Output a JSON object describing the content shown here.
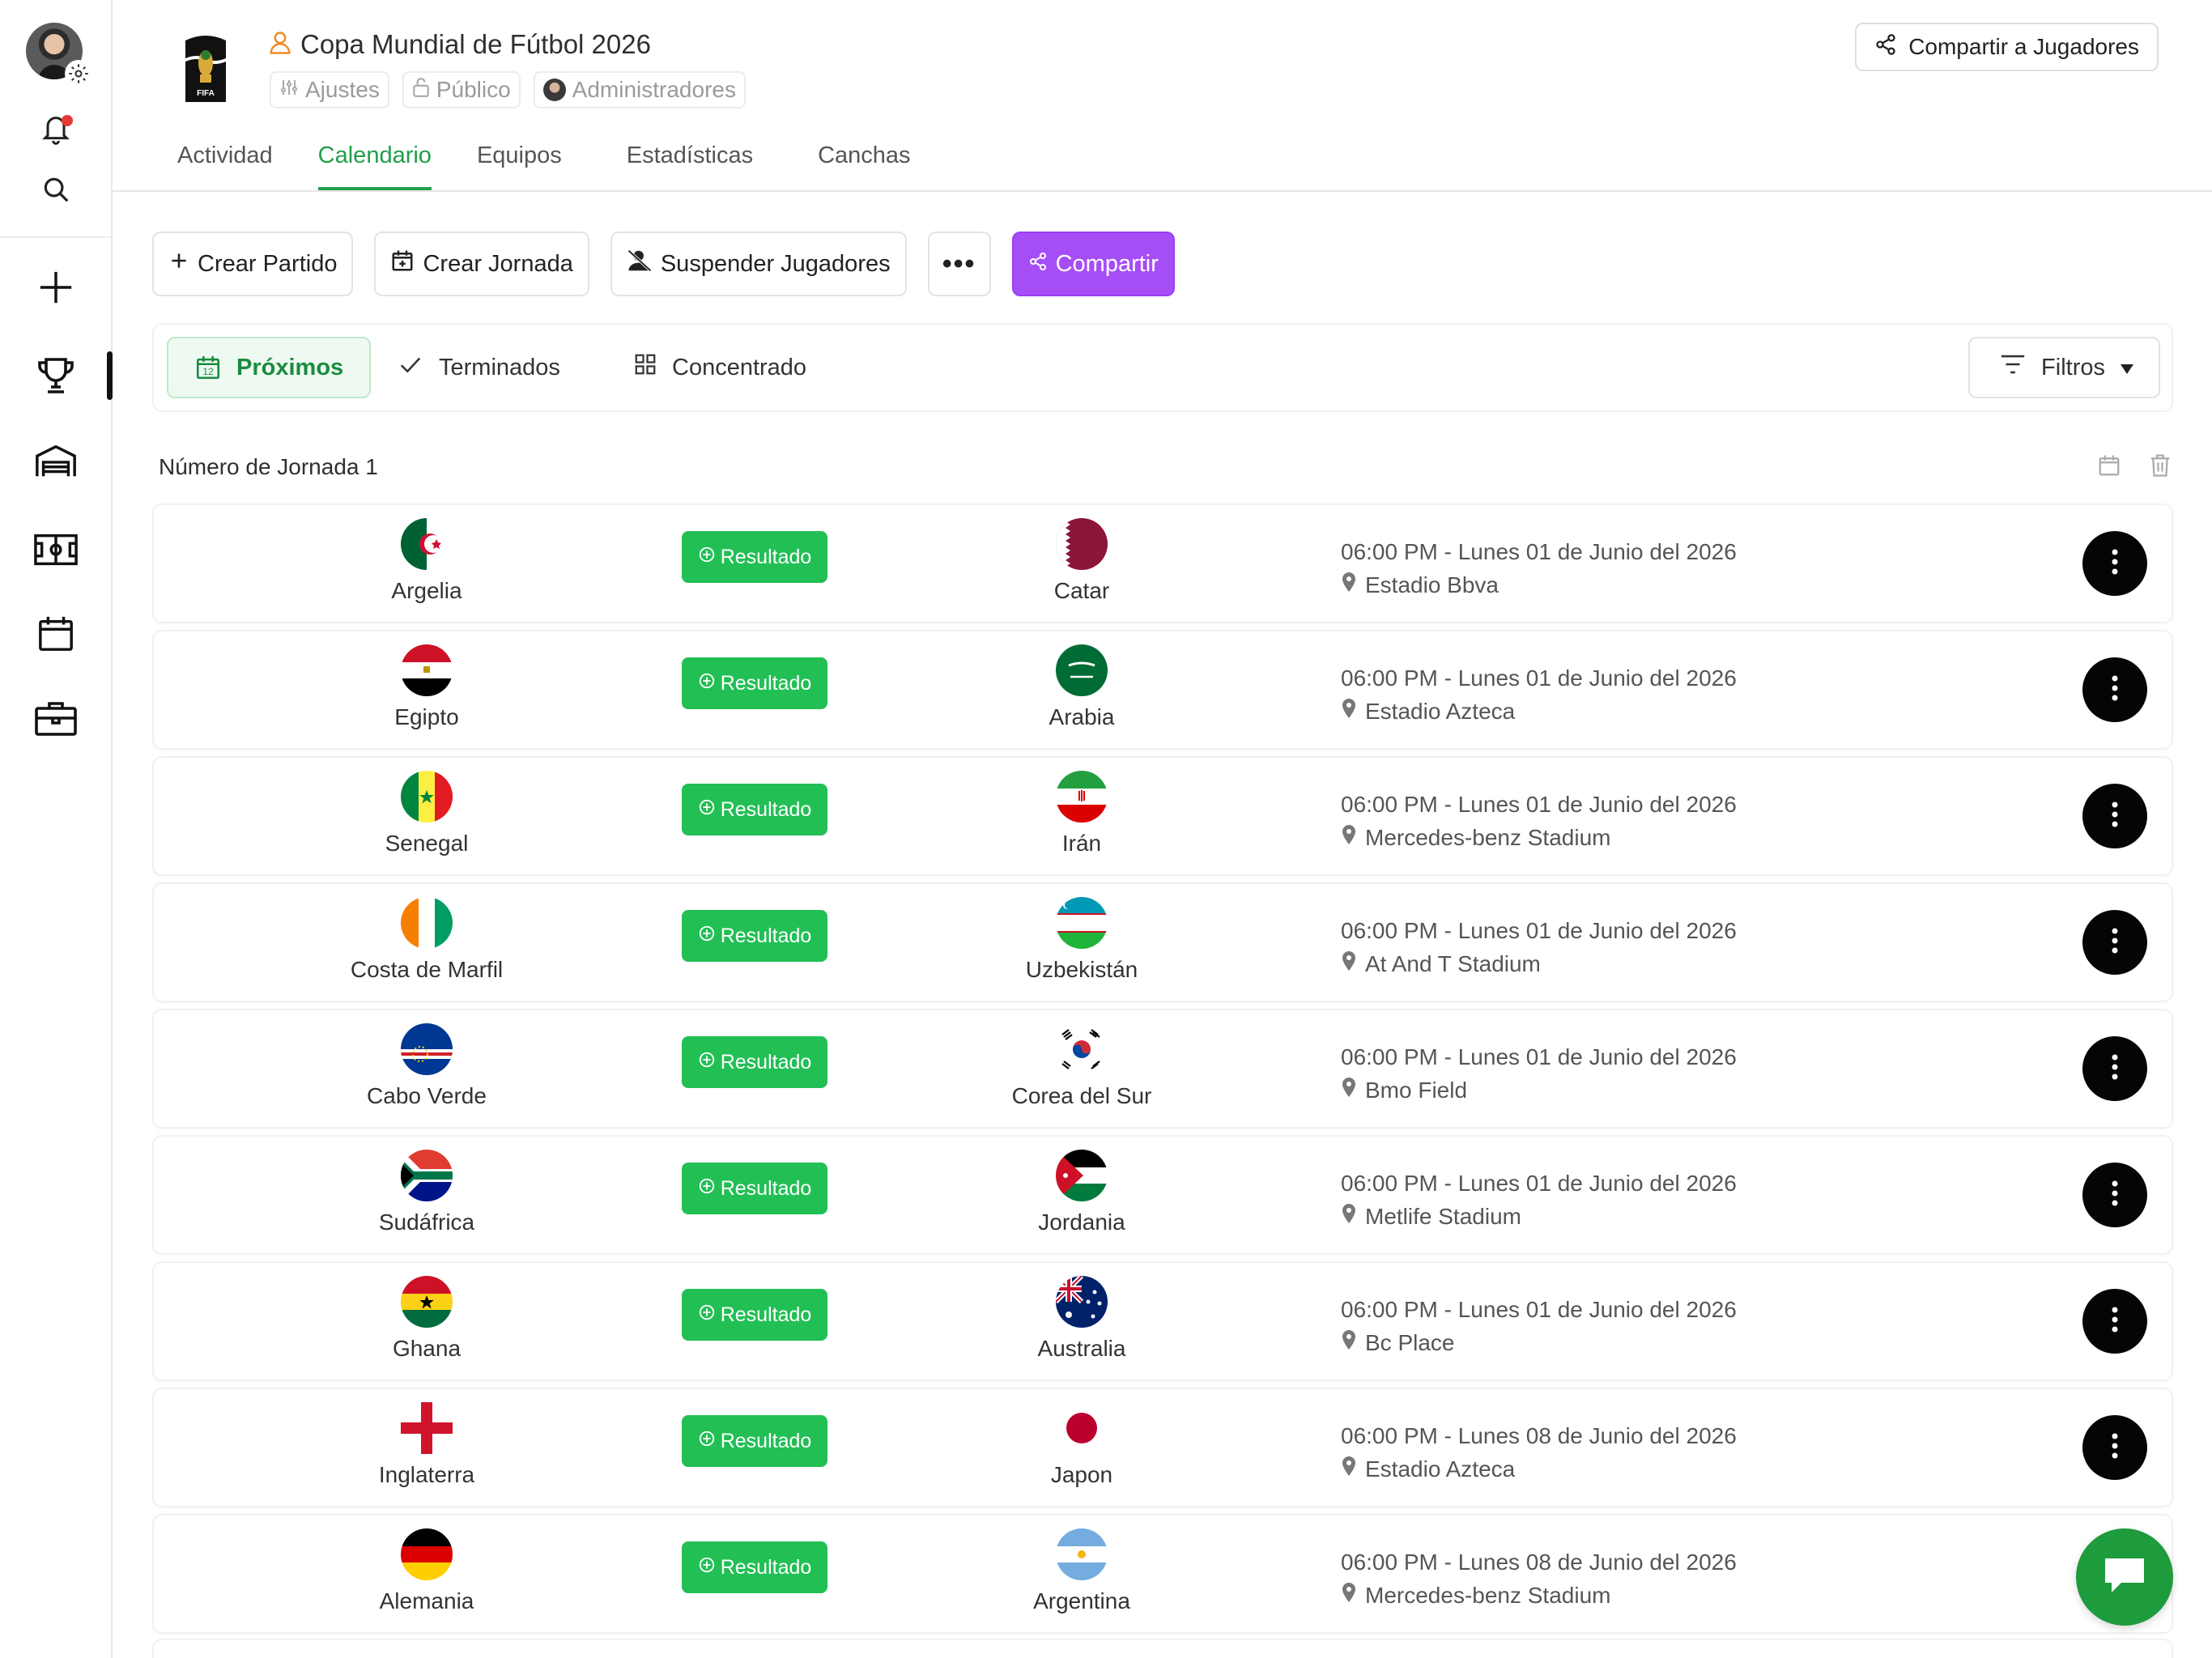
{
  "header": {
    "title": "Copa Mundial de Fútbol 2026",
    "chips": {
      "settings": "Ajustes",
      "visibility": "Público",
      "admins": "Administradores"
    },
    "share_button": "Compartir a Jugadores",
    "tabs": [
      {
        "label": "Actividad"
      },
      {
        "label": "Calendario"
      },
      {
        "label": "Equipos"
      },
      {
        "label": "Estadísticas"
      },
      {
        "label": "Canchas"
      }
    ],
    "active_tab": "Calendario"
  },
  "toolbar": {
    "create_match": "Crear Partido",
    "create_round": "Crear Jornada",
    "suspend_players": "Suspender Jugadores",
    "more": "•••",
    "share": "Compartir"
  },
  "filterbar": {
    "upcoming": "Próximos",
    "calendar_day": "12",
    "finished": "Terminados",
    "concentrated": "Concentrado",
    "filters": "Filtros"
  },
  "jornada": {
    "title": "Número de Jornada 1"
  },
  "result_label": "Resultado",
  "matches": [
    {
      "home": "Argelia",
      "away": "Catar",
      "datetime": "06:00 PM - Lunes 01 de Junio del 2026",
      "venue": "Estadio Bbva"
    },
    {
      "home": "Egipto",
      "away": "Arabia",
      "datetime": "06:00 PM - Lunes 01 de Junio del 2026",
      "venue": "Estadio Azteca"
    },
    {
      "home": "Senegal",
      "away": "Irán",
      "datetime": "06:00 PM - Lunes 01 de Junio del 2026",
      "venue": "Mercedes-benz Stadium"
    },
    {
      "home": "Costa de Marfil",
      "away": "Uzbekistán",
      "datetime": "06:00 PM - Lunes 01 de Junio del 2026",
      "venue": "At And T Stadium"
    },
    {
      "home": "Cabo Verde",
      "away": "Corea del Sur",
      "datetime": "06:00 PM - Lunes 01 de Junio del 2026",
      "venue": "Bmo Field"
    },
    {
      "home": "Sudáfrica",
      "away": "Jordania",
      "datetime": "06:00 PM - Lunes 01 de Junio del 2026",
      "venue": "Metlife Stadium"
    },
    {
      "home": "Ghana",
      "away": "Australia",
      "datetime": "06:00 PM - Lunes 01 de Junio del 2026",
      "venue": "Bc Place"
    },
    {
      "home": "Inglaterra",
      "away": "Japon",
      "datetime": "06:00 PM - Lunes 08 de Junio del 2026",
      "venue": "Estadio Azteca"
    },
    {
      "home": "Alemania",
      "away": "Argentina",
      "datetime": "06:00 PM - Lunes 08 de Junio del 2026",
      "venue": "Mercedes-benz Stadium"
    }
  ],
  "colors": {
    "accent_green": "#22a04f",
    "result_green": "#22bf55",
    "share_purple": "#a64ef6",
    "notification_dot": "#e53935"
  }
}
